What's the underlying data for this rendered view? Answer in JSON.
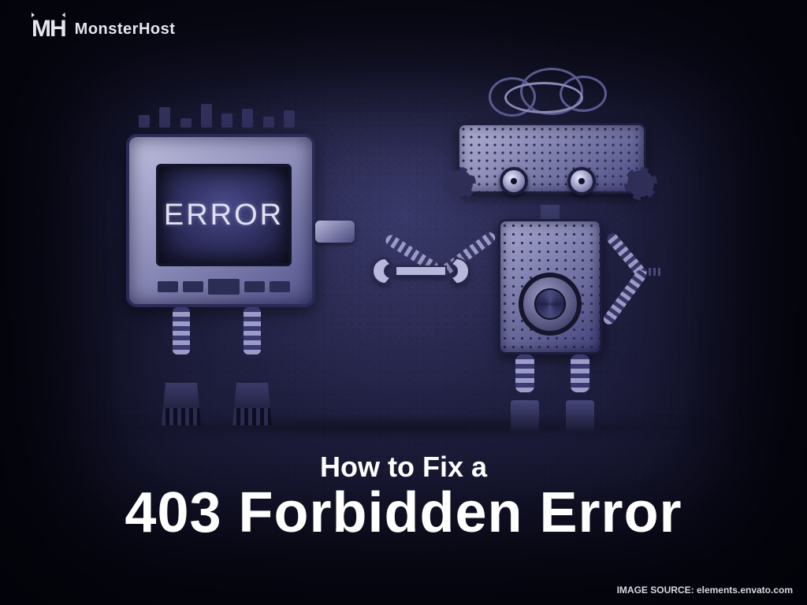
{
  "brand": {
    "mark": "MH",
    "name": "MonsterHost"
  },
  "scene": {
    "error_screen_text": "ERROR"
  },
  "title": {
    "line1": "How to Fix a",
    "line2": "403 Forbidden Error"
  },
  "credit": {
    "label": "IMAGE SOURCE:",
    "value": "elements.envato.com"
  }
}
